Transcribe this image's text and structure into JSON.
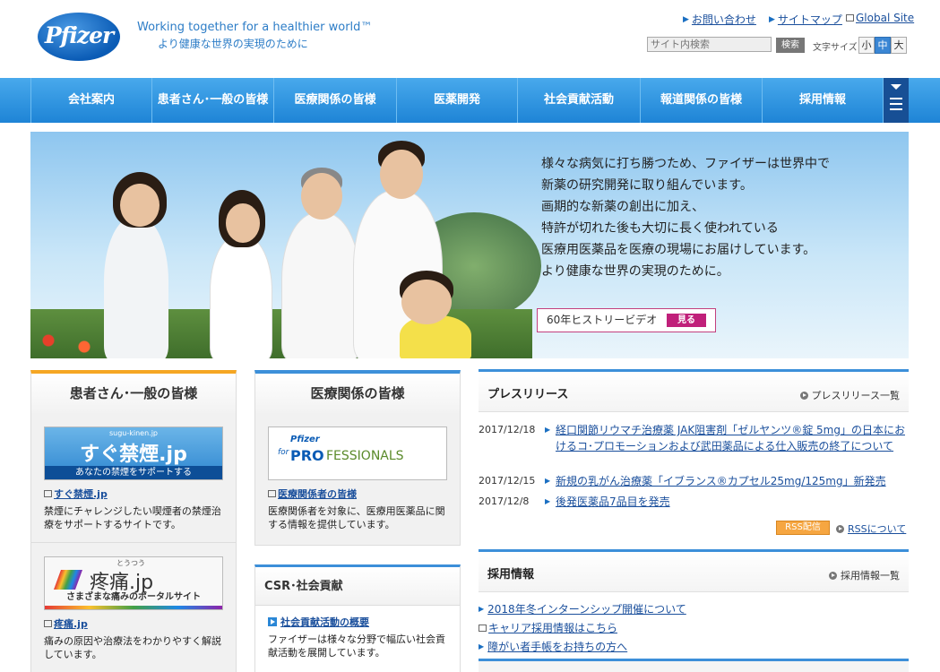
{
  "header": {
    "logo_text": "Pfizer",
    "tagline_en": "Working together for a healthier world™",
    "tagline_ja": "より健康な世界の実現のために",
    "util_links": [
      "お問い合わせ",
      "サイトマップ",
      "Global Site"
    ],
    "search_placeholder": "サイト内検索",
    "search_button": "検索",
    "font_size_label": "文字サイズ",
    "font_sizes": [
      "小",
      "中",
      "大"
    ],
    "font_size_selected": "中"
  },
  "nav": {
    "items": [
      "会社案内",
      "患者さん･一般の皆様",
      "医療関係の皆様",
      "医薬開発",
      "社会貢献活動",
      "報道関係の皆様",
      "採用情報"
    ]
  },
  "hero": {
    "lines": [
      "様々な病気に打ち勝つため、ファイザーは世界中で",
      "新薬の研究開発に取り組んでいます。",
      "画期的な新薬の創出に加え、",
      "特許が切れた後も大切に長く使われている",
      "医療用医薬品を医療の現場にお届けしています。",
      "より健康な世界の実現のために。"
    ],
    "video_label": "60年ヒストリービデオ",
    "video_button": "見る"
  },
  "patients": {
    "heading": "患者さん･一般の皆様",
    "card1": {
      "banner_url": "sugu-kinen.jp",
      "banner_title": "すぐ禁煙.jp",
      "banner_sub": "あなたの禁煙をサポートする",
      "link": "すぐ禁煙.jp",
      "desc": "禁煙にチャレンジしたい喫煙者の禁煙治療をサポートするサイトです。"
    },
    "card2": {
      "banner_ruby": "とうつう",
      "banner_title": "疼痛.jp",
      "banner_sub": "さまざまな痛みのポータルサイト",
      "link": "疼痛.jp",
      "desc": "痛みの原因や治療法をわかりやすく解説しています。"
    }
  },
  "medical": {
    "heading": "医療関係の皆様",
    "banner_top": "Pfizer",
    "banner_for": "for",
    "banner_pro": "PRO",
    "banner_rest": "FESSIONALS",
    "link": "医療関係者の皆様",
    "desc": "医療関係者を対象に、医療用医薬品に関する情報を提供しています。"
  },
  "csr": {
    "heading": "CSR･社会貢献",
    "link": "社会貢献活動の概要",
    "desc": "ファイザーは様々な分野で幅広い社会貢献活動を展開しています。"
  },
  "press": {
    "heading": "プレスリリース",
    "more": "プレスリリース一覧",
    "items": [
      {
        "date": "2017/12/18",
        "title": "経口関節リウマチ治療薬 JAK阻害剤「ゼルヤンツ®錠 5mg」の日本におけるコ･プロモーションおよび武田薬品による仕入販売の終了について"
      },
      {
        "date": "2017/12/15",
        "title": "新規の乳がん治療薬「イブランス®カプセル25mg/125mg」新発売"
      },
      {
        "date": "2017/12/8",
        "title": "後発医薬品7品目を発売"
      }
    ],
    "rss_label": "RSS配信",
    "rss_about": "RSSについて"
  },
  "recruit": {
    "heading": "採用情報",
    "more": "採用情報一覧",
    "items": [
      "2018年冬インターンシップ開催について",
      "キャリア採用情報はこちら",
      "障がい者手帳をお持ちの方へ"
    ]
  },
  "colors": {
    "brand_blue": "#0a5bb5",
    "nav_blue": "#1e84d6",
    "patients_accent": "#f5a623",
    "medical_accent": "#3c8fd9",
    "video_pink": "#c0207a"
  }
}
